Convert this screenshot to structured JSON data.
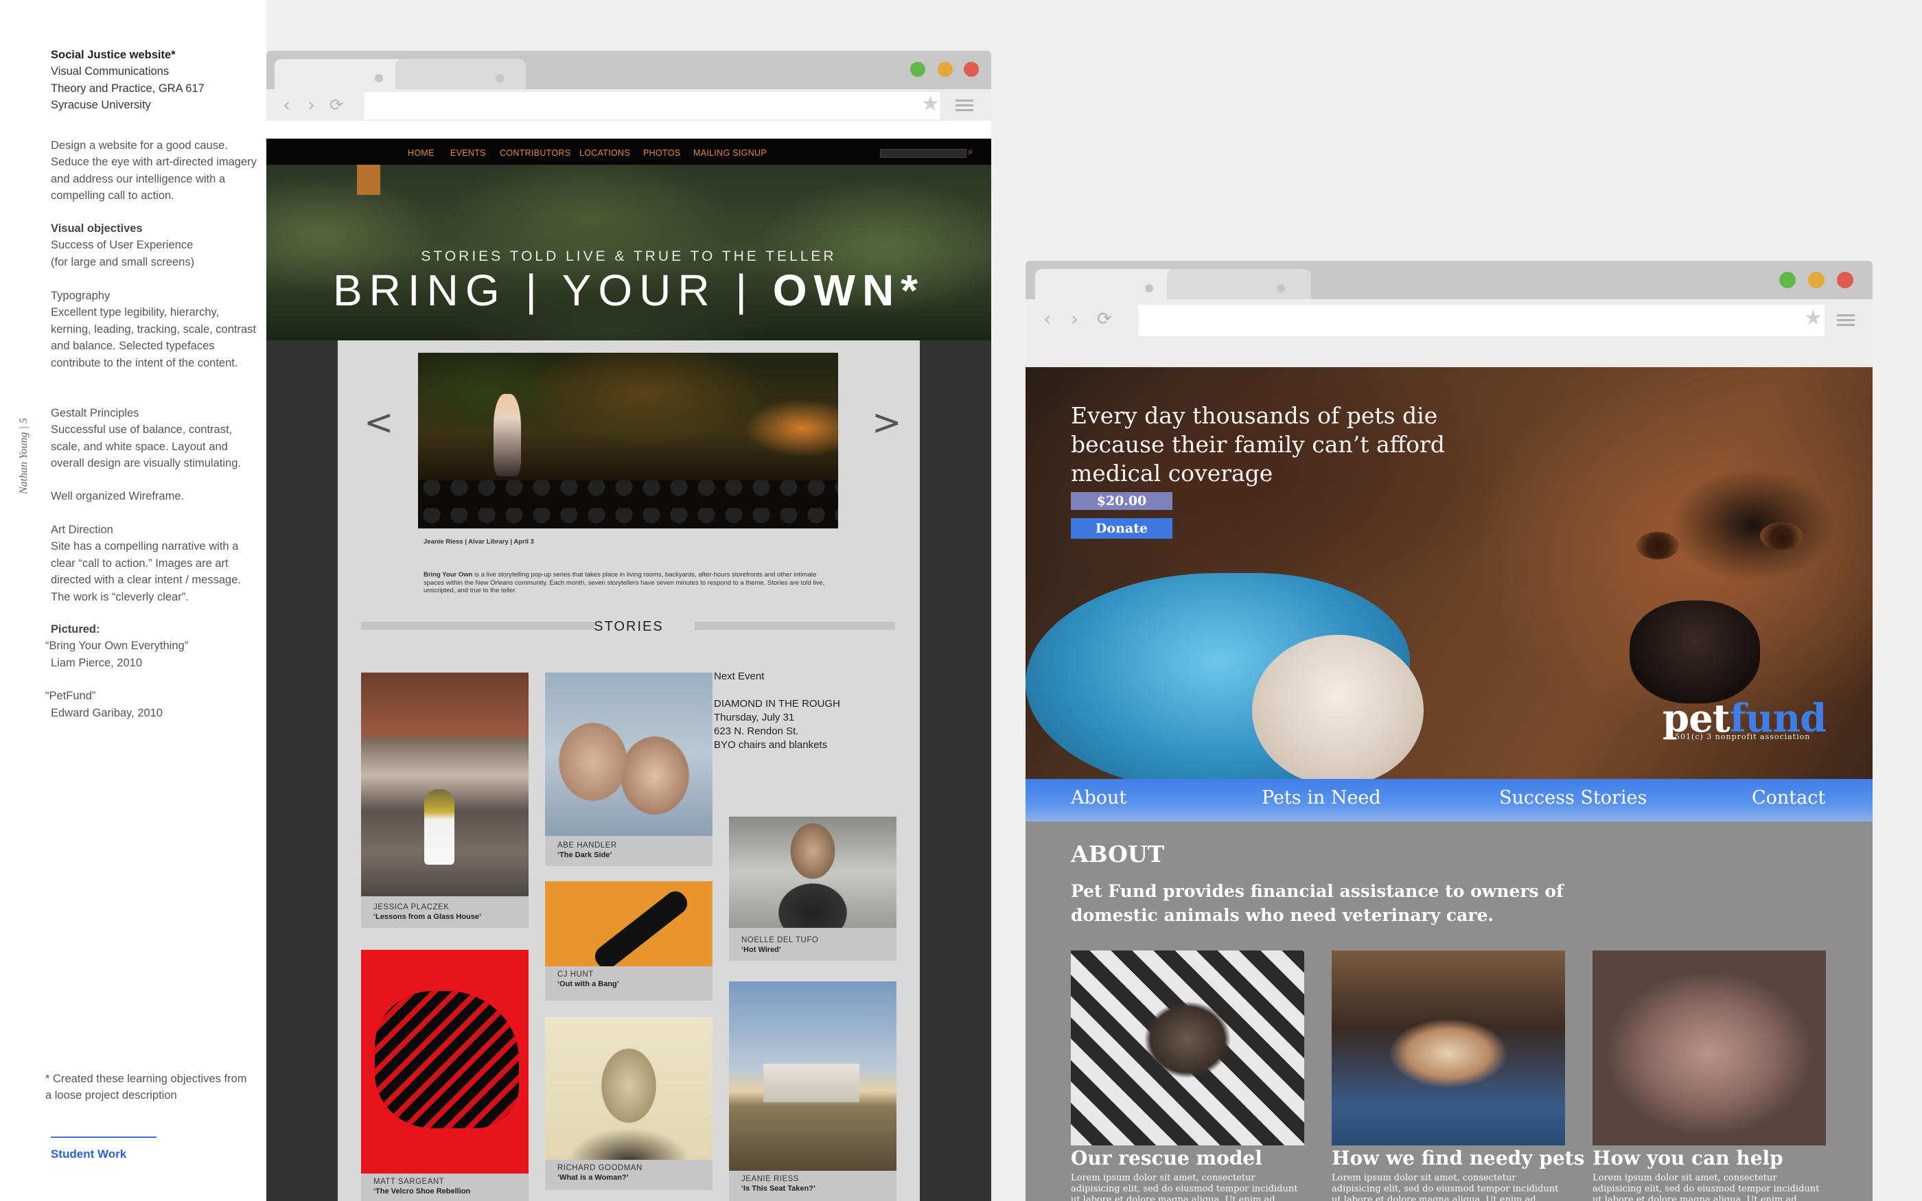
{
  "sidebar": {
    "title": "Social Justice website*",
    "course_lines": [
      "Visual Communications",
      "Theory and Practice, GRA 617",
      "Syracuse University"
    ],
    "description": "Design a website for a good cause. Seduce the eye with art-directed imagery and address our intelligence with a compelling call to action.",
    "visual_objectives_heading": "Visual objectives",
    "visual_objectives_text": "Success of User Experience (for large and small screens)",
    "typography_heading": "Typography",
    "typography_text": "Excellent type legibility, hierarchy, kerning, leading, tracking, scale, contrast and balance. Selected typefaces contribute to the intent of the content.",
    "gestalt_heading": "Gestalt Principles",
    "gestalt_text": "Successful use of balance, contrast, scale, and white space. Layout and overall design are visually stimulating.",
    "wireframe_text": "Well organized Wireframe.",
    "art_direction_heading": "Art Direction",
    "art_direction_text": "Site has a compelling narrative with a clear “call to action.” Images are art directed with a clear intent / message. The work is “cleverly clear”.",
    "pictured_heading": "Pictured:",
    "pictured_1_title": "“Bring Your Own Everything”",
    "pictured_1_author": "Liam Pierce, 2010",
    "pictured_2_title": "“PetFund”",
    "pictured_2_author": "Edward Garibay, 2010",
    "vertical_credit": "Nathan Young  |  5",
    "footnote": "*  Created these learning objectives from a loose project description",
    "student_work_link": "Student Work"
  },
  "browser_chrome": {
    "back_icon": "‹",
    "forward_icon": "›",
    "reload_icon": "⟳",
    "star_icon": "★",
    "win_colors": [
      "#5fb848",
      "#e6a83a",
      "#e25b50"
    ]
  },
  "byo": {
    "nav": [
      "HOME",
      "EVENTS",
      "CONTRIBUTORS",
      "LOCATIONS",
      "PHOTOS",
      "MAILING SIGNUP"
    ],
    "search_icon": "⌕",
    "tagline": "STORIES TOLD LIVE & TRUE TO THE TELLER",
    "title_part1": "BRING | YOUR |",
    "title_part2": "OWN*",
    "prev_arrow": "<",
    "next_arrow": ">",
    "feature_caption": "Jeanie Riess | Alvar Library | April 3",
    "intro_bold": "Bring Your Own",
    "intro_text": " is a live storytelling pop-up series that takes place in living rooms, backyards, after-hours storefronts and other intimate spaces within the New Orleans community. Each month, seven storytellers have seven minutes to respond to a theme. Stories are told live, unscripted, and true to the teller.",
    "stories_heading": "STORIES",
    "stories": [
      {
        "name": "JESSICA PLACZEK",
        "title": "‘Lessons from a Glass House’"
      },
      {
        "name": "ABE HANDLER",
        "title": "‘The Dark Side’"
      },
      {
        "name": "NOELLE DEL TUFO",
        "title": "‘Hot Wired’"
      },
      {
        "name": "CJ HUNT",
        "title": "‘Out with a Bang’"
      },
      {
        "name": "MATT SARGEANT",
        "title": "‘The Velcro Shoe Rebellion"
      },
      {
        "name": "RICHARD GOODMAN",
        "title": "‘What is a Woman?’"
      },
      {
        "name": "JEANIE RIESS",
        "title": "‘Is This Seat Taken?’"
      }
    ],
    "next_event": {
      "label": "Next Event",
      "name": "DIAMOND IN THE ROUGH",
      "date": "Thursday, July 31",
      "address": "623 N. Rendon St.",
      "note": "BYO chairs and blankets"
    }
  },
  "petfund": {
    "headline": "Every day thousands of pets die because their family can’t afford medical coverage",
    "amount": "$20.00",
    "donate_label": "Donate",
    "logo_pet": "pet",
    "logo_fund": "fund",
    "logo_tagline": "a 501(c) 3 nonprofit association",
    "nav": [
      "About",
      "Pets in Need",
      "Success Stories",
      "Contact"
    ],
    "about_heading": "ABOUT",
    "about_text": "Pet Fund provides financial assistance to owners of domestic animals who need veterinary care.",
    "cards": [
      {
        "title": "Our rescue model",
        "text": "Lorem ipsum dolor sit amet, consectetur adipisicing elit, sed do eiusmod tempor incididunt ut labore et dolore magna aliqua. Ut enim ad"
      },
      {
        "title": "How we find needy pets",
        "text": "Lorem ipsum dolor sit amet, consectetur adipisicing elit, sed do eiusmod tempor incididunt ut labore et dolore magna aliqua. Ut enim ad"
      },
      {
        "title": "How you can help",
        "text": "Lorem ipsum dolor sit amet, consectetur adipisicing elit, sed do eiusmod tempor incididunt ut labore et dolore magna aliqua. Ut enim ad"
      }
    ],
    "accent_color": "#3e7ee8"
  }
}
